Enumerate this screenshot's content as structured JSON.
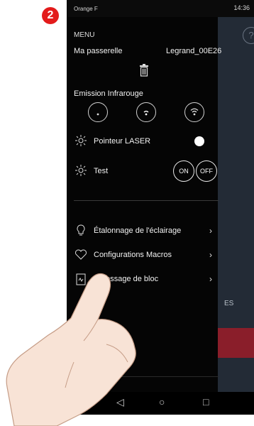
{
  "step_number": "2",
  "status_bar": {
    "carrier": "Orange F",
    "time": "14:36"
  },
  "drawer": {
    "menu_title": "MENU",
    "gateway_label": "Ma passerelle",
    "gateway_name": "Legrand_00E26",
    "infrared_label": "Emission Infrarouge",
    "laser_label": "Pointeur LASER",
    "test_label": "Test",
    "on_label": "ON",
    "off_label": "OFF",
    "items": [
      {
        "label": "Étalonnage de l'éclairage"
      },
      {
        "label": "Configurations Macros"
      },
      {
        "label": "Adressage de bloc"
      }
    ]
  },
  "background": {
    "partial_label": "ES",
    "help_glyph": "?"
  },
  "colors": {
    "badge": "#e31b1b",
    "drawer": "#050505",
    "background_accent": "#8a1e2a"
  }
}
